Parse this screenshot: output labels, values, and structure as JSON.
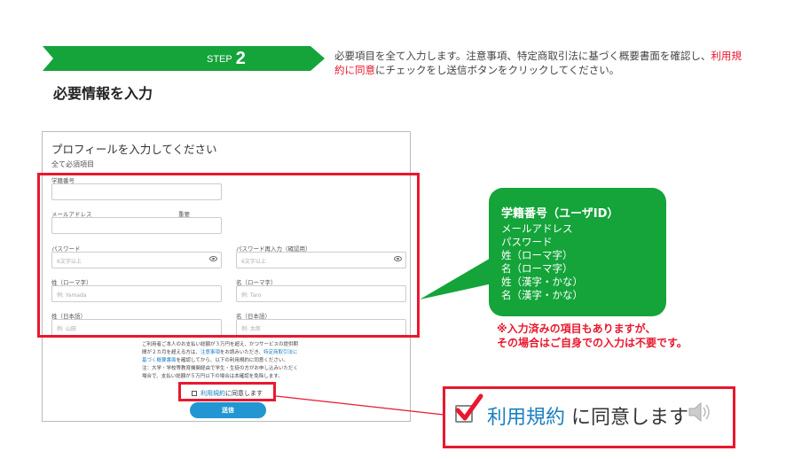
{
  "step": {
    "label": "STEP",
    "number": "2"
  },
  "title": "必要情報を入力",
  "description": {
    "part1": "必要項目を全て入力します。注意事項、特定商取引法に基づく概要書面を確認し、",
    "highlight": "利用規約に同意",
    "part2": "にチェックをし送信ボタンをクリックしてください。"
  },
  "form": {
    "title": "プロフィールを入力してください",
    "required_note": "全て必須項目",
    "student_id": {
      "label": "学籍番号",
      "value": ""
    },
    "email": {
      "label": "メールアドレス",
      "tag": "重要",
      "value": ""
    },
    "password": {
      "label": "パスワード",
      "placeholder": "6文字以上"
    },
    "password_confirm": {
      "label": "パスワード再入力（確認用）",
      "placeholder": "6文字以上"
    },
    "last_name_roman": {
      "label": "姓（ローマ字）",
      "placeholder": "例: Yamada"
    },
    "first_name_roman": {
      "label": "名（ローマ字）",
      "placeholder": "例: Taro"
    },
    "last_name_jp": {
      "label": "姓（日本語）",
      "placeholder": "例: 山田"
    },
    "first_name_jp": {
      "label": "名（日本語）",
      "placeholder": "例: 太郎"
    },
    "notice_line1": "ご利用者ご本人のお支払い総額が３万円を超え、かつサービスの提供期",
    "notice_line2a": "間が２カ月を超える方は、",
    "notice_link1": "注意事項",
    "notice_line2b": "をお読みいただき、",
    "notice_link2": "特定商取引法に",
    "notice_link3": "基づく概要書面",
    "notice_line3": "を確認してから、以下の利用規約に同意ください。",
    "notice_line4": "注：大学・学校等教育機関経由で学生・生徒の方がお申し込みいただく",
    "notice_line5": "場合で、支払い総額が５万円以下の場合は本確認を免除します。",
    "terms_link": "利用規約",
    "terms_suffix": "に同意します",
    "submit": "送信"
  },
  "callout": {
    "head": "学籍番号（ユーザID）",
    "items": [
      "メールアドレス",
      "パスワード",
      "姓（ローマ字）",
      "名（ローマ字）",
      "姓（漢字・かな）",
      "名（漢字・かな）"
    ]
  },
  "warning": {
    "line1": "※入力済みの項目もありますが、",
    "line2": "その場合はご自身での入力は不要です。"
  },
  "zoom": {
    "link": "利用規約",
    "suffix": " に同意します"
  },
  "colors": {
    "green": "#14a43a",
    "red": "#e8182e",
    "link": "#1a7fc1",
    "button": "#2196d3"
  }
}
